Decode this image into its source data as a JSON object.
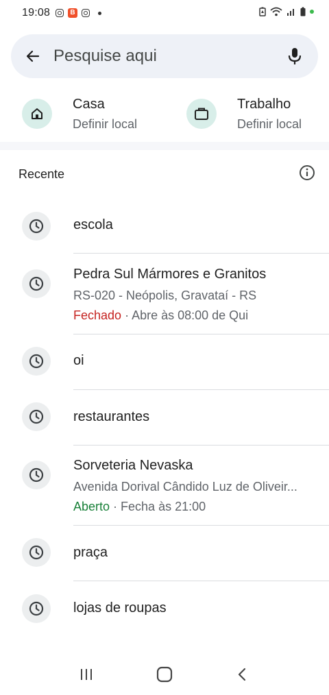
{
  "status_bar": {
    "time": "19:08",
    "notif_app_label": "B"
  },
  "search": {
    "placeholder": "Pesquise aqui"
  },
  "saved_places": [
    {
      "title": "Casa",
      "subtitle": "Definir local"
    },
    {
      "title": "Trabalho",
      "subtitle": "Definir local"
    }
  ],
  "recent": {
    "heading": "Recente",
    "items": [
      {
        "label": "escola"
      },
      {
        "label": "Pedra Sul Mármores e Granitos",
        "address": "RS-020 - Neópolis, Gravataí - RS",
        "status": "Fechado",
        "hours": " · Abre às 08:00 de Qui"
      },
      {
        "label": "oi"
      },
      {
        "label": "restaurantes"
      },
      {
        "label": "Sorveteria Nevaska",
        "address": "Avenida Dorival Cândido Luz de Oliveir...",
        "status": "Aberto",
        "hours": " · Fecha às 21:00"
      },
      {
        "label": "praça"
      },
      {
        "label": "lojas de roupas"
      }
    ]
  },
  "colors": {
    "closed": "#c5221f",
    "open": "#188038",
    "search_bg": "#eef1f7",
    "place_icon_bg": "#d8eee9"
  }
}
